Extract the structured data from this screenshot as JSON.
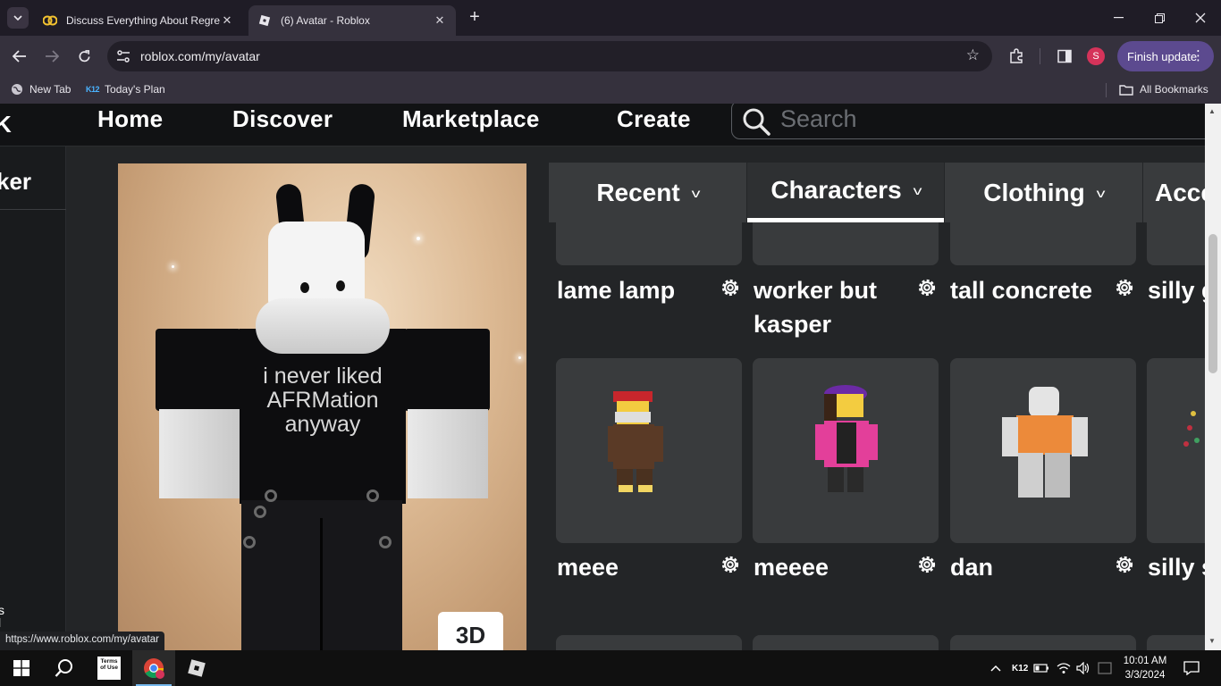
{
  "browser": {
    "tabs": [
      {
        "title": "Discuss Everything About Regre",
        "active": false
      },
      {
        "title": "(6) Avatar - Roblox",
        "active": true
      }
    ],
    "url": "roblox.com/my/avatar",
    "finish_update_label": "Finish update",
    "profile_initial": "S",
    "bookmarks": [
      {
        "label": "New Tab",
        "icon": "globe-icon"
      },
      {
        "label": "Today's Plan",
        "icon": "k12-icon",
        "badge": "K12"
      }
    ],
    "all_bookmarks_label": "All Bookmarks",
    "status_url": "https://www.roblox.com/my/avatar"
  },
  "roblox": {
    "nav": {
      "logo_fragment": "K",
      "links": [
        "Home",
        "Discover",
        "Marketplace",
        "Create"
      ],
      "search_placeholder": "Search"
    },
    "left_panel": {
      "title_fragment": "ker",
      "footer_fragment": "s\nl"
    },
    "preview": {
      "shirt_text": "i never liked\nAFRMation\nanyway",
      "view_3d_label": "3D"
    },
    "category_tabs": [
      {
        "label": "Recent",
        "active": false
      },
      {
        "label": "Characters",
        "active": true
      },
      {
        "label": "Clothing",
        "active": false
      },
      {
        "label": "Acce",
        "active": false
      }
    ],
    "characters_row1": [
      "lame lamp",
      "worker but kasper",
      "tall concrete",
      "silly g"
    ],
    "characters_row2": [
      "meee",
      "meeee",
      "dan",
      "silly s soul"
    ]
  },
  "taskbar": {
    "pinned_app_label": "Terms of Use",
    "tray_keyboard": "K12",
    "time": "10:01 AM",
    "date": "3/3/2024"
  },
  "colors": {
    "tab_strip": "#1f1c26",
    "toolbar": "#35313d",
    "finish_update": "#5c4a8f",
    "roblox_nav": "#111214",
    "roblox_bg": "#232527",
    "card": "#393b3d"
  }
}
